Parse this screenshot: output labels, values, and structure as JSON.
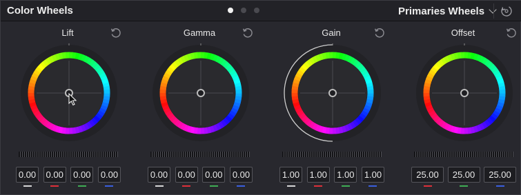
{
  "header": {
    "title": "Color Wheels",
    "mode_label": "Primaries Wheels",
    "pages": 3,
    "active_page": 0
  },
  "wheels": [
    {
      "name": "Lift",
      "values": [
        "0.00",
        "0.00",
        "0.00",
        "0.00"
      ],
      "channels": [
        "master",
        "red",
        "green",
        "blue"
      ],
      "active_cursor": true
    },
    {
      "name": "Gamma",
      "values": [
        "0.00",
        "0.00",
        "0.00",
        "0.00"
      ],
      "channels": [
        "master",
        "red",
        "green",
        "blue"
      ]
    },
    {
      "name": "Gain",
      "values": [
        "1.00",
        "1.00",
        "1.00",
        "1.00"
      ],
      "channels": [
        "master",
        "red",
        "green",
        "blue"
      ],
      "outer_arc": true
    },
    {
      "name": "Offset",
      "values": [
        "25.00",
        "25.00",
        "25.00"
      ],
      "channels": [
        "red",
        "green",
        "blue"
      ]
    }
  ],
  "colors": {
    "master": "#d8d8d8",
    "red": "#e0303a",
    "green": "#3fae55",
    "blue": "#3a5fe0",
    "panel_bg": "#28282e"
  },
  "icons": {
    "reset": "reset-icon",
    "mode_dropdown": "chevron-down-icon",
    "global_reset": "reset-all-icon"
  }
}
